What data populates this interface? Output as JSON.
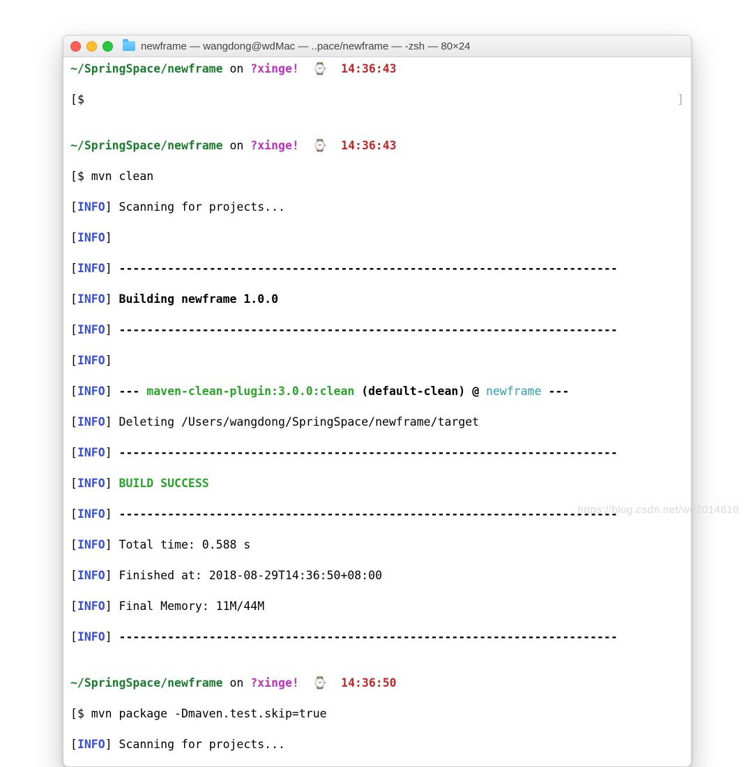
{
  "window": {
    "title": "newframe — wangdong@wdMac — ..pace/newframe — -zsh — 80×24"
  },
  "prompt": {
    "path": "~/SpringSpace/newframe",
    "on": " on ",
    "branch_box": "?",
    "branch": "xinge!",
    "watch": "⌚",
    "time1": "14:36:43",
    "time2": "14:36:43",
    "time3": "14:36:50"
  },
  "cmd": {
    "empty": "$ ",
    "clean": "$ mvn clean",
    "package": "$ mvn package -Dmaven.test.skip=true"
  },
  "info": {
    "tag_open": "[",
    "tag": "INFO",
    "tag_close": "]",
    "scan": " Scanning for projects...",
    "dash": " ------------------------------------------------------------------------",
    "building": " Building newframe 1.0.0",
    "plugin_dash_l": " --- ",
    "plugin": "maven-clean-plugin:3.0.0:clean",
    "plugin_goal": " (default-clean) @ ",
    "plugin_proj": "newframe",
    "plugin_dash_r": " ---",
    "deleting": " Deleting /Users/wangdong/SpringSpace/newframe/target",
    "buildsuccess": " BUILD SUCCESS",
    "totaltime": " Total time: 0.588 s",
    "finished": " Finished at: 2018-08-29T14:36:50+08:00",
    "memory": " Final Memory: 11M/44M"
  },
  "brackets": {
    "l": "[",
    "r": "]"
  },
  "watermark": "https://blog.csdn.net/wd2014610"
}
